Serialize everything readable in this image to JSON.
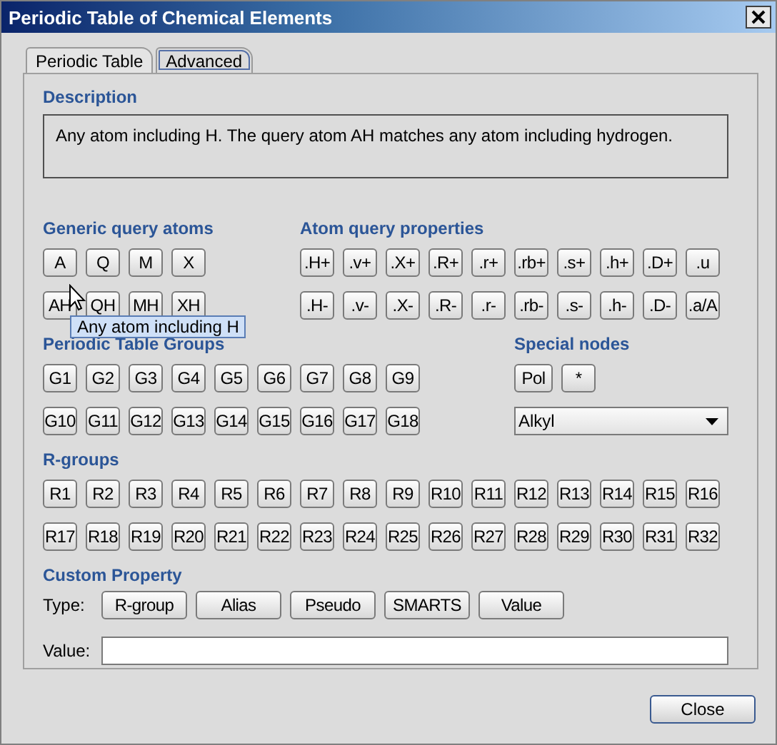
{
  "window": {
    "title": "Periodic Table of Chemical Elements"
  },
  "tabs": [
    {
      "label": "Periodic Table",
      "selected": false
    },
    {
      "label": "Advanced",
      "selected": true
    }
  ],
  "description": {
    "heading": "Description",
    "text": "Any atom including H. The query atom AH matches any atom including hydrogen."
  },
  "generic_query_atoms": {
    "heading": "Generic query atoms",
    "rows": [
      [
        "A",
        "Q",
        "M",
        "X"
      ],
      [
        "AH",
        "QH",
        "MH",
        "XH"
      ]
    ]
  },
  "atom_query_properties": {
    "heading": "Atom query properties",
    "rows": [
      [
        ".H+",
        ".v+",
        ".X+",
        ".R+",
        ".r+",
        ".rb+",
        ".s+",
        ".h+",
        ".D+",
        ".u"
      ],
      [
        ".H-",
        ".v-",
        ".X-",
        ".R-",
        ".r-",
        ".rb-",
        ".s-",
        ".h-",
        ".D-",
        ".a/A"
      ]
    ]
  },
  "periodic_table_groups": {
    "heading": "Periodic Table Groups",
    "rows": [
      [
        "G1",
        "G2",
        "G3",
        "G4",
        "G5",
        "G6",
        "G7",
        "G8",
        "G9"
      ],
      [
        "G10",
        "G11",
        "G12",
        "G13",
        "G14",
        "G15",
        "G16",
        "G17",
        "G18"
      ]
    ]
  },
  "special_nodes": {
    "heading": "Special nodes",
    "buttons": [
      "Pol",
      "*"
    ],
    "dropdown": {
      "value": "Alkyl"
    }
  },
  "r_groups": {
    "heading": "R-groups",
    "rows": [
      [
        "R1",
        "R2",
        "R3",
        "R4",
        "R5",
        "R6",
        "R7",
        "R8",
        "R9",
        "R10",
        "R11",
        "R12",
        "R13",
        "R14",
        "R15",
        "R16"
      ],
      [
        "R17",
        "R18",
        "R19",
        "R20",
        "R21",
        "R22",
        "R23",
        "R24",
        "R25",
        "R26",
        "R27",
        "R28",
        "R29",
        "R30",
        "R31",
        "R32"
      ]
    ]
  },
  "custom_property": {
    "heading": "Custom Property",
    "type_label": "Type:",
    "type_buttons": [
      "R-group",
      "Alias",
      "Pseudo",
      "SMARTS",
      "Value"
    ],
    "value_label": "Value:"
  },
  "tooltip": {
    "text": "Any atom including H"
  },
  "footer": {
    "close_button": "Close"
  }
}
